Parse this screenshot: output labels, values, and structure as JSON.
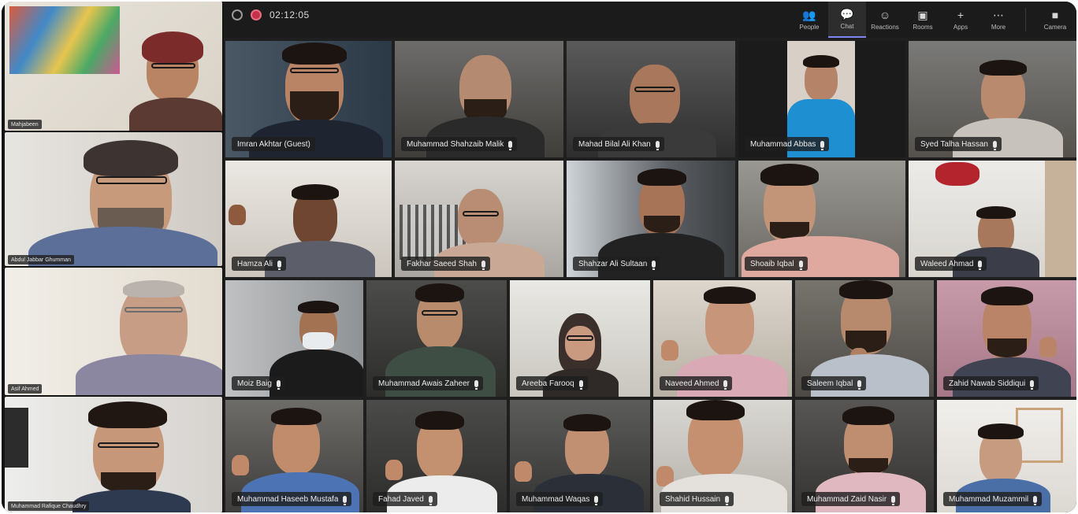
{
  "meeting": {
    "timer": "02:12:05",
    "toolbar": [
      {
        "label": "People",
        "icon": "people-icon",
        "glyph": "👥"
      },
      {
        "label": "Chat",
        "icon": "chat-icon",
        "glyph": "💬",
        "active": true
      },
      {
        "label": "Reactions",
        "icon": "reactions-icon",
        "glyph": "☺"
      },
      {
        "label": "Rooms",
        "icon": "rooms-icon",
        "glyph": "▣"
      },
      {
        "label": "Apps",
        "icon": "apps-icon",
        "glyph": "+"
      },
      {
        "label": "More",
        "icon": "more-icon",
        "glyph": "⋯"
      },
      {
        "label": "Camera",
        "icon": "camera-icon",
        "glyph": "■"
      }
    ]
  },
  "side_participants": [
    {
      "name": "Mahjabeen"
    },
    {
      "name": "Abdul Jabbar Ghumman"
    },
    {
      "name": "Asif Ahmed"
    },
    {
      "name": "Muhammad Rafique Chaudhry"
    }
  ],
  "participants": [
    {
      "name": "Imran Akhtar (Guest)"
    },
    {
      "name": "Muhammad Shahzaib Malik"
    },
    {
      "name": "Mahad Bilal Ali Khan"
    },
    {
      "name": "Muhammad Abbas"
    },
    {
      "name": "Syed Talha Hassan"
    },
    {
      "name": "Hamza Ali"
    },
    {
      "name": "Fakhar Saeed Shah"
    },
    {
      "name": "Shahzar Ali Sultaan"
    },
    {
      "name": "Shoaib Iqbal"
    },
    {
      "name": "Waleed Ahmad"
    },
    {
      "name": "Moiz Baig"
    },
    {
      "name": "Muhammad Awais Zaheer"
    },
    {
      "name": "Areeba Farooq"
    },
    {
      "name": "Naveed Ahmed"
    },
    {
      "name": "Saleem Iqbal"
    },
    {
      "name": "Zahid Nawab Siddiqui"
    },
    {
      "name": "Muhammad Haseeb Mustafa"
    },
    {
      "name": "Fahad Javed"
    },
    {
      "name": "Muhammad Waqas"
    },
    {
      "name": "Shahid Hussain"
    },
    {
      "name": "Muhammad Zaid Nasir"
    },
    {
      "name": "Muhammad Muzammil"
    }
  ]
}
